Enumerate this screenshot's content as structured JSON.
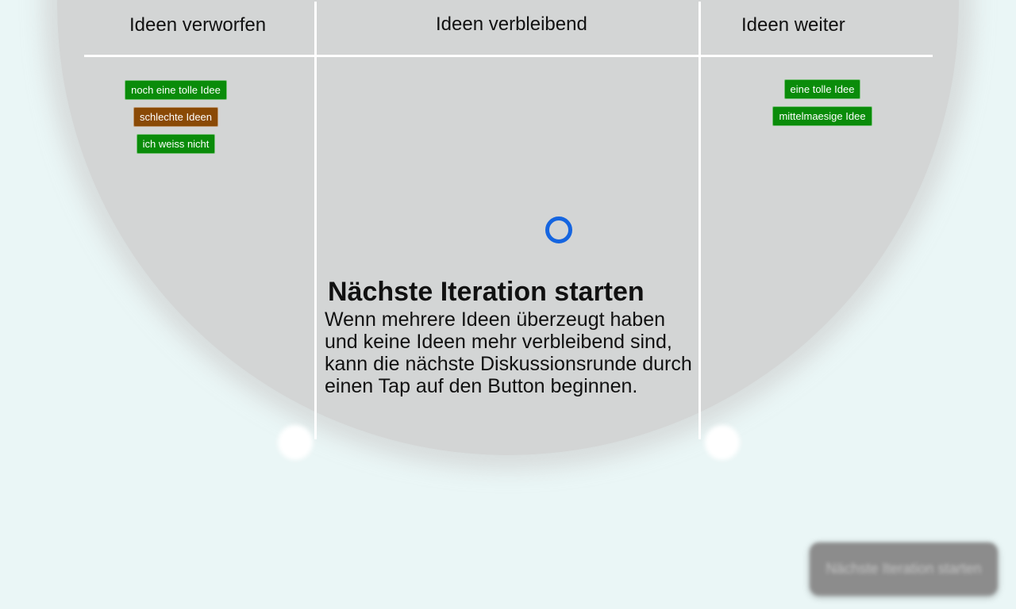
{
  "board": {
    "columns": [
      {
        "title": "Ideen verworfen",
        "ideas": [
          {
            "label": "noch eine tolle Idee",
            "color": "#0a8c0a"
          },
          {
            "label": "schlechte Ideen",
            "color": "#8a4a06"
          },
          {
            "label": "ich weiss nicht",
            "color": "#0a8c0a"
          }
        ]
      },
      {
        "title": "Ideen verbleibend",
        "ideas": []
      },
      {
        "title": "Ideen weiter",
        "ideas": [
          {
            "label": "eine tolle Idee",
            "color": "#0a8c0a"
          },
          {
            "label": "mittelmaesige Idee",
            "color": "#0a8c0a"
          }
        ]
      }
    ]
  },
  "tutorial": {
    "title": "Nächste Iteration starten",
    "body": "Wenn mehrere Ideen überzeugt haben und keine Ideen mehr verbleibend sind, kann die nächste Diskussionsrunde durch einen Tap auf den Button beginnen."
  },
  "next_button": {
    "label": "Nächste Iteration starten"
  },
  "colors": {
    "focus_ring": "#1565e0",
    "background": "#eaf6f6",
    "overlay": "#cccccc"
  }
}
